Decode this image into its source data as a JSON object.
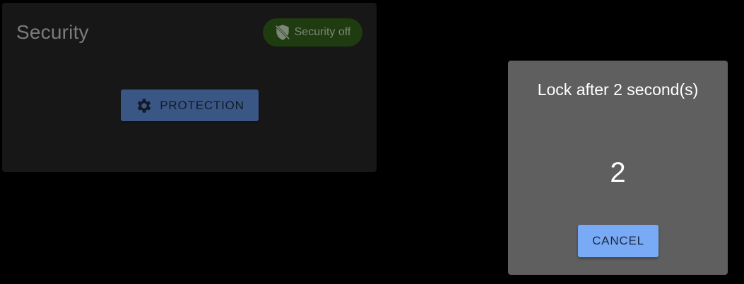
{
  "security_card": {
    "title": "Security",
    "status_badge": {
      "label": "Security off",
      "icon": "shield-off-icon",
      "color": "#1f3b10"
    },
    "protection_button": {
      "label": "PROTECTION",
      "icon": "gear-icon",
      "color": "#3a5685"
    }
  },
  "lock_dialog": {
    "title": "Lock after 2 second(s)",
    "countdown": "2",
    "cancel_label": "CANCEL",
    "accent": "#79aaf5"
  }
}
